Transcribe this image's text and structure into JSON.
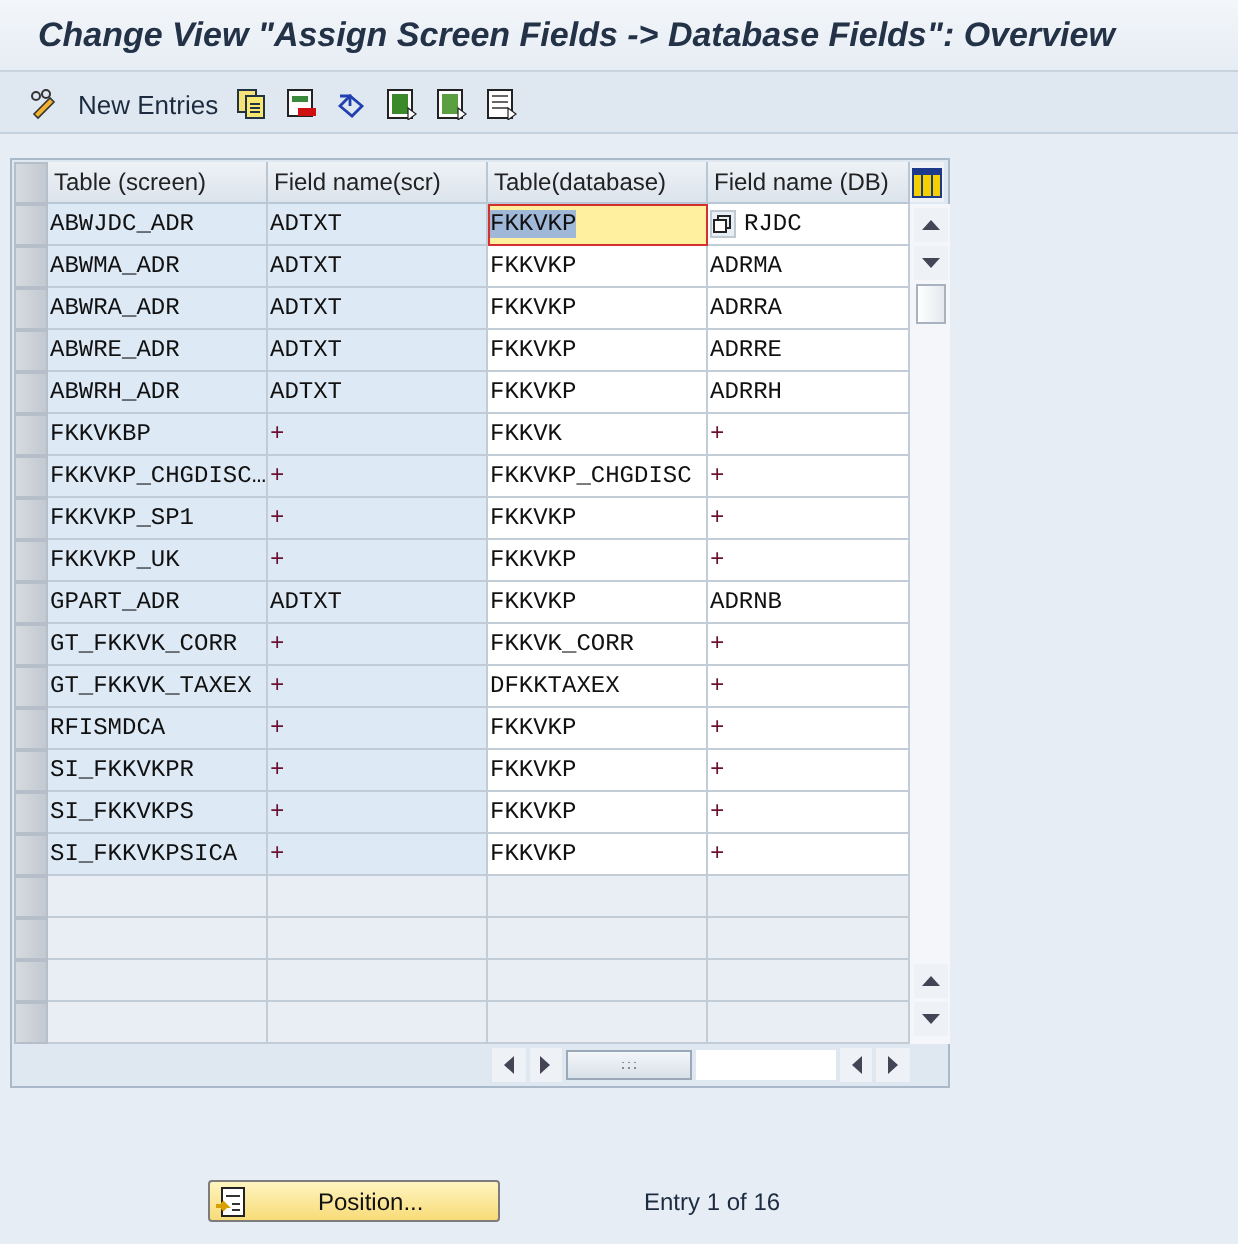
{
  "window": {
    "title": "Change View \"Assign Screen Fields -> Database Fields\": Overview"
  },
  "toolbar": {
    "new_entries": "New Entries"
  },
  "table": {
    "columns": [
      {
        "label": "Table (screen)",
        "key": true
      },
      {
        "label": "Field name(scr)",
        "key": true
      },
      {
        "label": "Table(database)",
        "key": false
      },
      {
        "label": "Field name (DB)",
        "key": false
      }
    ],
    "rows": [
      {
        "cells": [
          {
            "text": "ABWJDC_ADR",
            "selected": false
          },
          {
            "text": "ADTXT",
            "selected": false
          },
          {
            "text": "FKKVKP",
            "selected": true
          },
          {
            "text": "RJDC",
            "selected": false
          }
        ]
      },
      {
        "cells": [
          {
            "text": "ABWMA_ADR",
            "selected": false
          },
          {
            "text": "ADTXT",
            "selected": false
          },
          {
            "text": "FKKVKP",
            "selected": false
          },
          {
            "text": "ADRMA",
            "selected": false
          }
        ]
      },
      {
        "cells": [
          {
            "text": "ABWRA_ADR",
            "selected": false
          },
          {
            "text": "ADTXT",
            "selected": false
          },
          {
            "text": "FKKVKP",
            "selected": false
          },
          {
            "text": "ADRRA",
            "selected": false
          }
        ]
      },
      {
        "cells": [
          {
            "text": "ABWRE_ADR",
            "selected": false
          },
          {
            "text": "ADTXT",
            "selected": false
          },
          {
            "text": "FKKVKP",
            "selected": false
          },
          {
            "text": "ADRRE",
            "selected": false
          }
        ]
      },
      {
        "cells": [
          {
            "text": "ABWRH_ADR",
            "selected": false
          },
          {
            "text": "ADTXT",
            "selected": false
          },
          {
            "text": "FKKVKP",
            "selected": false
          },
          {
            "text": "ADRRH",
            "selected": false
          }
        ]
      },
      {
        "cells": [
          {
            "text": "FKKVKBP",
            "selected": false
          },
          {
            "text": "+",
            "selected": false
          },
          {
            "text": "FKKVK",
            "selected": false
          },
          {
            "text": "+",
            "selected": false
          }
        ]
      },
      {
        "cells": [
          {
            "text": "FKKVKP_CHGDISC…",
            "selected": false
          },
          {
            "text": "+",
            "selected": false
          },
          {
            "text": "FKKVKP_CHGDISC",
            "selected": false
          },
          {
            "text": "+",
            "selected": false
          }
        ]
      },
      {
        "cells": [
          {
            "text": "FKKVKP_SP1",
            "selected": false
          },
          {
            "text": "+",
            "selected": false
          },
          {
            "text": "FKKVKP",
            "selected": false
          },
          {
            "text": "+",
            "selected": false
          }
        ]
      },
      {
        "cells": [
          {
            "text": "FKKVKP_UK",
            "selected": false
          },
          {
            "text": "+",
            "selected": false
          },
          {
            "text": "FKKVKP",
            "selected": false
          },
          {
            "text": "+",
            "selected": false
          }
        ]
      },
      {
        "cells": [
          {
            "text": "GPART_ADR",
            "selected": false
          },
          {
            "text": "ADTXT",
            "selected": false
          },
          {
            "text": "FKKVKP",
            "selected": false
          },
          {
            "text": "ADRNB",
            "selected": false
          }
        ]
      },
      {
        "cells": [
          {
            "text": "GT_FKKVK_CORR",
            "selected": false
          },
          {
            "text": "+",
            "selected": false
          },
          {
            "text": "FKKVK_CORR",
            "selected": false
          },
          {
            "text": "+",
            "selected": false
          }
        ]
      },
      {
        "cells": [
          {
            "text": "GT_FKKVK_TAXEX",
            "selected": false
          },
          {
            "text": "+",
            "selected": false
          },
          {
            "text": "DFKKTAXEX",
            "selected": false
          },
          {
            "text": "+",
            "selected": false
          }
        ]
      },
      {
        "cells": [
          {
            "text": "RFISMDCA",
            "selected": false
          },
          {
            "text": "+",
            "selected": false
          },
          {
            "text": "FKKVKP",
            "selected": false
          },
          {
            "text": "+",
            "selected": false
          }
        ]
      },
      {
        "cells": [
          {
            "text": "SI_FKKVKPR",
            "selected": false
          },
          {
            "text": "+",
            "selected": false
          },
          {
            "text": "FKKVKP",
            "selected": false
          },
          {
            "text": "+",
            "selected": false
          }
        ]
      },
      {
        "cells": [
          {
            "text": "SI_FKKVKPS",
            "selected": false
          },
          {
            "text": "+",
            "selected": false
          },
          {
            "text": "FKKVKP",
            "selected": false
          },
          {
            "text": "+",
            "selected": false
          }
        ]
      },
      {
        "cells": [
          {
            "text": "SI_FKKVKPSICA",
            "selected": false
          },
          {
            "text": "+",
            "selected": false
          },
          {
            "text": "FKKVKP",
            "selected": false
          },
          {
            "text": "+",
            "selected": false
          }
        ]
      }
    ]
  },
  "footer": {
    "position_button": "Position...",
    "entry_info": "Entry 1 of 16"
  }
}
